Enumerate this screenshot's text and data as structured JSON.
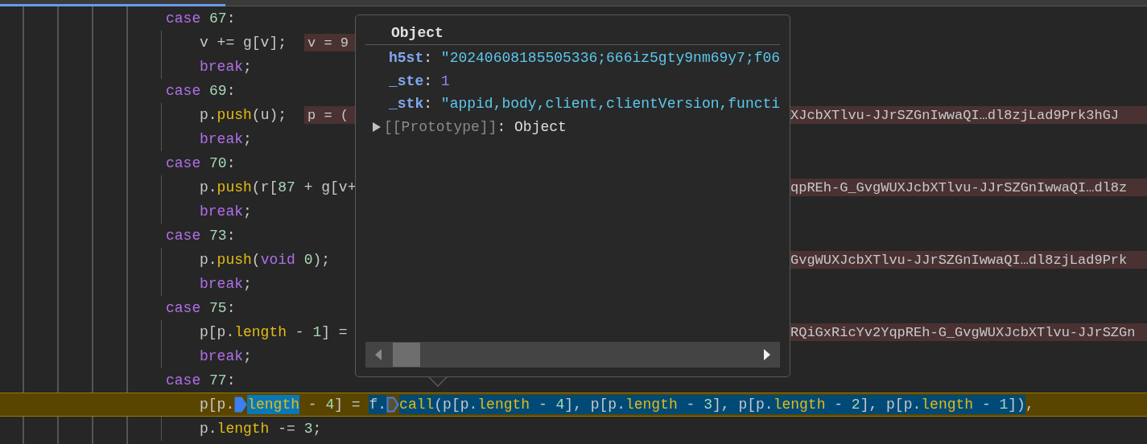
{
  "editor": {
    "lines": [
      {
        "tokens": [
          {
            "kind": "keyword",
            "text": "case"
          },
          {
            "kind": "number",
            "text": " 67"
          },
          {
            "kind": "plain",
            "text": ":"
          }
        ],
        "current": false,
        "children": [
          {
            "tokens": [
              {
                "kind": "plain",
                "text": "v += g[v];"
              }
            ],
            "current": false,
            "value_left": "v = 9"
          },
          {
            "tokens": [
              {
                "kind": "keyword",
                "text": "break"
              },
              {
                "kind": "plain",
                "text": ";"
              }
            ],
            "current": false
          }
        ]
      },
      {
        "tokens": [
          {
            "kind": "keyword",
            "text": "case"
          },
          {
            "kind": "number",
            "text": " 69"
          },
          {
            "kind": "plain",
            "text": ":"
          }
        ],
        "current": false,
        "children": [
          {
            "tokens": [
              {
                "kind": "plain",
                "text": "p."
              },
              {
                "kind": "property",
                "text": "push"
              },
              {
                "kind": "plain",
                "text": "(u);"
              }
            ],
            "current": false,
            "value_left": "p = (",
            "value_right": "XJcbXTlvu-JJrSZGnIwwaQI…dl8zjLad9Prk3hGJ"
          },
          {
            "tokens": [
              {
                "kind": "keyword",
                "text": "break"
              },
              {
                "kind": "plain",
                "text": ";"
              }
            ],
            "current": false
          }
        ]
      },
      {
        "tokens": [
          {
            "kind": "keyword",
            "text": "case"
          },
          {
            "kind": "number",
            "text": " 70"
          },
          {
            "kind": "plain",
            "text": ":"
          }
        ],
        "current": false,
        "children": [
          {
            "tokens": [
              {
                "kind": "plain",
                "text": "p."
              },
              {
                "kind": "property",
                "text": "push"
              },
              {
                "kind": "plain",
                "text": "(r["
              },
              {
                "kind": "number",
                "text": "87"
              },
              {
                "kind": "plain",
                "text": " + g[v+"
              }
            ],
            "current": false,
            "value_right": "qpREh-G_GvgWUXJcbXTlvu-JJrSZGnIwwaQI…dl8z"
          },
          {
            "tokens": [
              {
                "kind": "keyword",
                "text": "break"
              },
              {
                "kind": "plain",
                "text": ";"
              }
            ],
            "current": false
          }
        ]
      },
      {
        "tokens": [
          {
            "kind": "keyword",
            "text": "case"
          },
          {
            "kind": "number",
            "text": " 73"
          },
          {
            "kind": "plain",
            "text": ":"
          }
        ],
        "current": false,
        "children": [
          {
            "tokens": [
              {
                "kind": "plain",
                "text": "p."
              },
              {
                "kind": "property",
                "text": "push"
              },
              {
                "kind": "plain",
                "text": "("
              },
              {
                "kind": "keyword",
                "text": "void"
              },
              {
                "kind": "number",
                "text": " 0"
              },
              {
                "kind": "plain",
                "text": ");"
              }
            ],
            "current": false,
            "value_right": "GvgWUXJcbXTlvu-JJrSZGnIwwaQI…dl8zjLad9Prk"
          },
          {
            "tokens": [
              {
                "kind": "keyword",
                "text": "break"
              },
              {
                "kind": "plain",
                "text": ";"
              }
            ],
            "current": false
          }
        ]
      },
      {
        "tokens": [
          {
            "kind": "keyword",
            "text": "case"
          },
          {
            "kind": "number",
            "text": " 75"
          },
          {
            "kind": "plain",
            "text": ":"
          }
        ],
        "current": false,
        "children": [
          {
            "tokens": [
              {
                "kind": "plain",
                "text": "p[p."
              },
              {
                "kind": "property",
                "text": "length"
              },
              {
                "kind": "plain",
                "text": " - "
              },
              {
                "kind": "number",
                "text": "1"
              },
              {
                "kind": "plain",
                "text": "] ="
              }
            ],
            "current": false,
            "value_right": "RQiGxRicYv2YqpREh-G_GvgWUXJcbXTlvu-JJrSZGn"
          },
          {
            "tokens": [
              {
                "kind": "keyword",
                "text": "break"
              },
              {
                "kind": "plain",
                "text": ";"
              }
            ],
            "current": false
          }
        ]
      },
      {
        "tokens": [
          {
            "kind": "keyword",
            "text": "case"
          },
          {
            "kind": "number",
            "text": " 77"
          },
          {
            "kind": "plain",
            "text": ":"
          }
        ],
        "current": false,
        "children": [
          {
            "current": true,
            "tokens": [
              {
                "kind": "plain",
                "text": "p[p.",
                "selected": false,
                "hovered": false
              },
              {
                "kind": "marker",
                "active": true,
                "selected": false,
                "hovered": false
              },
              {
                "kind": "property",
                "text": "length",
                "selected": false,
                "hovered": true
              },
              {
                "kind": "plain",
                "text": " - ",
                "selected": false,
                "hovered": false
              },
              {
                "kind": "number",
                "text": "4",
                "selected": false,
                "hovered": false
              },
              {
                "kind": "plain",
                "text": "] = ",
                "selected": false,
                "hovered": false
              },
              {
                "kind": "plain",
                "text": "f.",
                "selected": true,
                "hovered": false
              },
              {
                "kind": "marker",
                "active": false,
                "selected": false,
                "hovered": false
              },
              {
                "kind": "property",
                "text": "call",
                "selected": true,
                "hovered": false
              },
              {
                "kind": "plain",
                "text": "(p[p.",
                "selected": true,
                "hovered": false
              },
              {
                "kind": "property",
                "text": "length",
                "selected": true,
                "hovered": false
              },
              {
                "kind": "plain",
                "text": " - ",
                "selected": true,
                "hovered": false
              },
              {
                "kind": "number",
                "text": "4",
                "selected": true,
                "hovered": false
              },
              {
                "kind": "plain",
                "text": "], p[p.",
                "selected": true,
                "hovered": false
              },
              {
                "kind": "property",
                "text": "length",
                "selected": true,
                "hovered": false
              },
              {
                "kind": "plain",
                "text": " - ",
                "selected": true,
                "hovered": false
              },
              {
                "kind": "number",
                "text": "3",
                "selected": true,
                "hovered": false
              },
              {
                "kind": "plain",
                "text": "], p[p.",
                "selected": true,
                "hovered": false
              },
              {
                "kind": "property",
                "text": "length",
                "selected": true,
                "hovered": false
              },
              {
                "kind": "plain",
                "text": " - ",
                "selected": true,
                "hovered": false
              },
              {
                "kind": "number",
                "text": "2",
                "selected": true,
                "hovered": false
              },
              {
                "kind": "plain",
                "text": "], p[p.",
                "selected": true,
                "hovered": false
              },
              {
                "kind": "property",
                "text": "length",
                "selected": true,
                "hovered": false
              },
              {
                "kind": "plain",
                "text": " - ",
                "selected": true,
                "hovered": false
              },
              {
                "kind": "number",
                "text": "1",
                "selected": true,
                "hovered": false
              },
              {
                "kind": "plain",
                "text": "])",
                "selected": true,
                "hovered": false
              },
              {
                "kind": "plain",
                "text": ",",
                "selected": false,
                "hovered": false
              }
            ]
          },
          {
            "tokens": [
              {
                "kind": "plain",
                "text": "p."
              },
              {
                "kind": "property",
                "text": "length"
              },
              {
                "kind": "plain",
                "text": " -= "
              },
              {
                "kind": "number",
                "text": "3"
              },
              {
                "kind": "plain",
                "text": ";"
              }
            ],
            "current": false
          }
        ]
      }
    ]
  },
  "popover": {
    "title": "Object",
    "properties": [
      {
        "key": "h5st",
        "separator": ":",
        "kind": "string",
        "value": "\"20240608185505336;666iz5gty9nm69y7;f06"
      },
      {
        "key": "_ste",
        "separator": ":",
        "kind": "number",
        "value": "1"
      },
      {
        "key": "_stk",
        "separator": ":",
        "kind": "string",
        "value": "\"appid,body,client,clientVersion,functi"
      }
    ],
    "prototype": {
      "label": "[[Prototype]]",
      "separator": ":",
      "value": "Object",
      "expanded": false
    }
  }
}
